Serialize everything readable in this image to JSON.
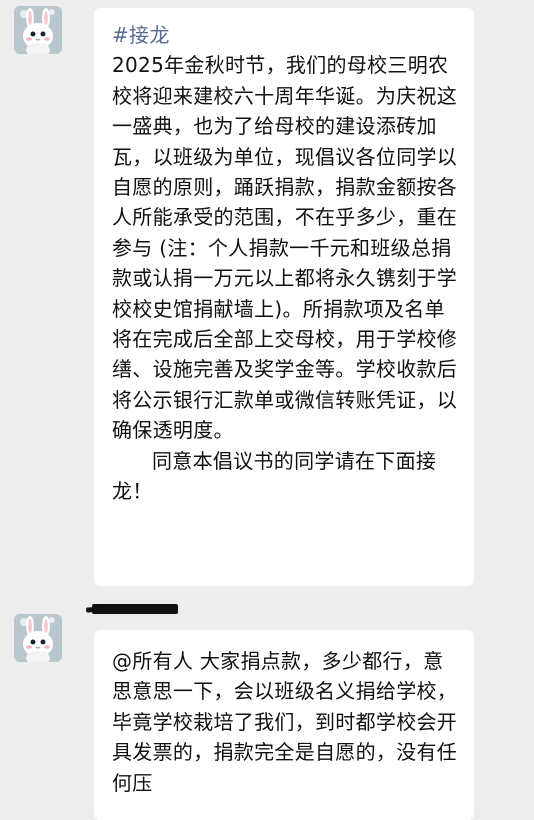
{
  "messages": [
    {
      "avatar_icon": "white-rabbit-avatar-icon",
      "tag": "#接龙",
      "body": "2025年金秋时节，我们的母校三明农校将迎来建校六十周年华诞。为庆祝这一盛典，也为了给母校的建设添砖加瓦，以班级为单位，现倡议各位同学以自愿的原则，踊跃捐款，捐款金额按各人所能承受的范围，不在乎多少，重在参与 (注：个人捐款一千元和班级总捐款或认捐一万元以上都将永久镌刻于学校校史馆捐献墙上)。所捐款项及名单将在完成后全部上交母校，用于学校修缮、设施完善及奖学金等。学校收款后将公示银行汇款单或微信转账凭证，以确保透明度。",
      "closing": "同意本倡议书的同学请在下面接龙！"
    },
    {
      "avatar_icon": "white-rabbit-avatar-icon",
      "body": "@所有人 大家捐点款，多少都行，意思意思一下，会以班级名义捐给学校，毕竟学校栽培了我们，到时都学校会开具发票的，捐款完全是自愿的，没有任何压"
    }
  ],
  "colors": {
    "background": "#ededed",
    "bubble": "#ffffff",
    "tag": "#576b95",
    "text": "#111111"
  }
}
